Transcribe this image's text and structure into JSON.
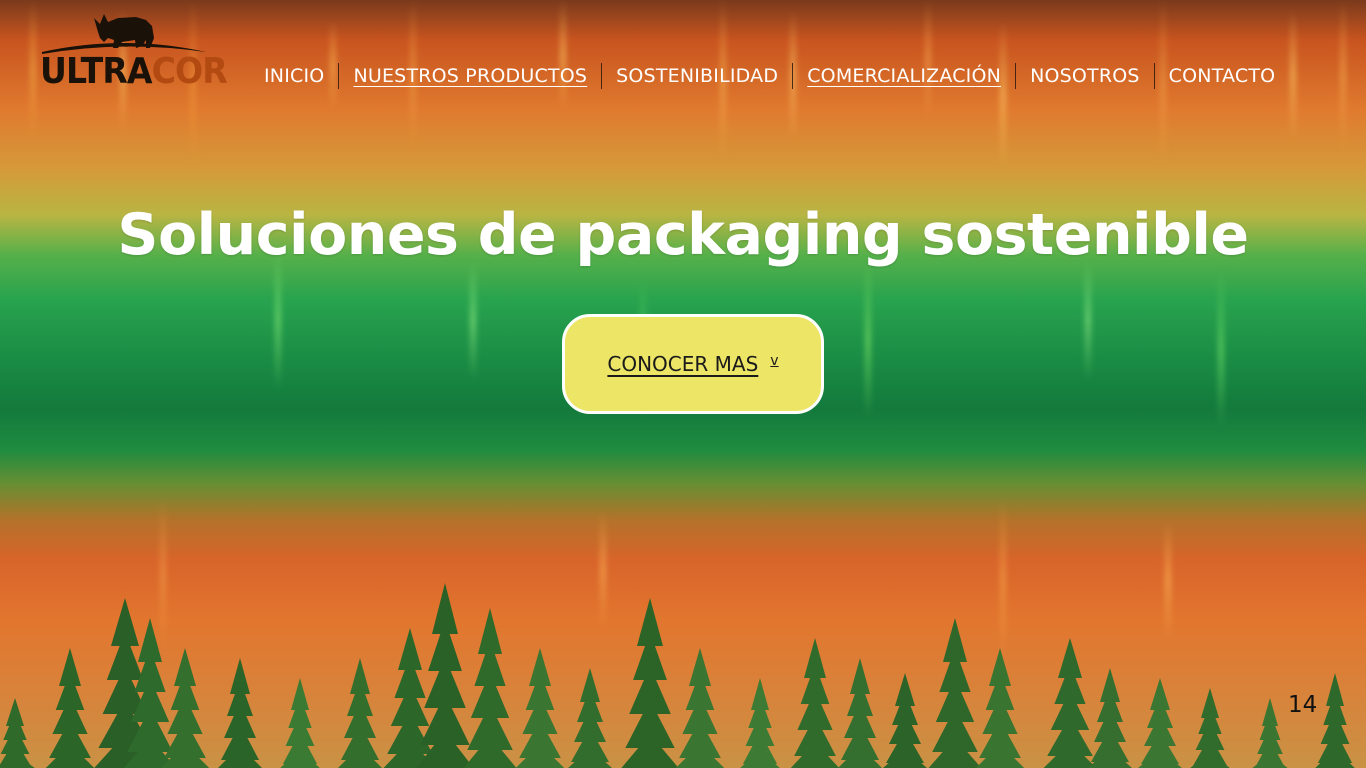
{
  "brand": {
    "name_part1": "ULTRA",
    "name_part2": "COR",
    "mascot_icon": "rhino-icon",
    "color_part1": "#1a1108",
    "color_part2": "#b24a12"
  },
  "nav": {
    "items": [
      {
        "label": "INICIO",
        "underlined": false
      },
      {
        "label": "NUESTROS PRODUCTOS",
        "underlined": true
      },
      {
        "label": "SOSTENIBILIDAD",
        "underlined": false
      },
      {
        "label": "COMERCIALIZACIÓN",
        "underlined": true
      },
      {
        "label": "NOSOTROS",
        "underlined": false
      },
      {
        "label": "CONTACTO",
        "underlined": false
      }
    ]
  },
  "hero": {
    "title": "Soluciones de packaging sostenible",
    "cta_label": "CONOCER MAS",
    "cta_icon": "chevron-down-icon",
    "cta_icon_glyph": "v",
    "cta_color": "#ede566"
  },
  "footer": {
    "page_number": "14"
  },
  "background": {
    "scene": "forest-aurora",
    "colors": [
      "#c8541f",
      "#e07a2e",
      "#28a34e",
      "#137a3c",
      "#d8642a"
    ]
  }
}
